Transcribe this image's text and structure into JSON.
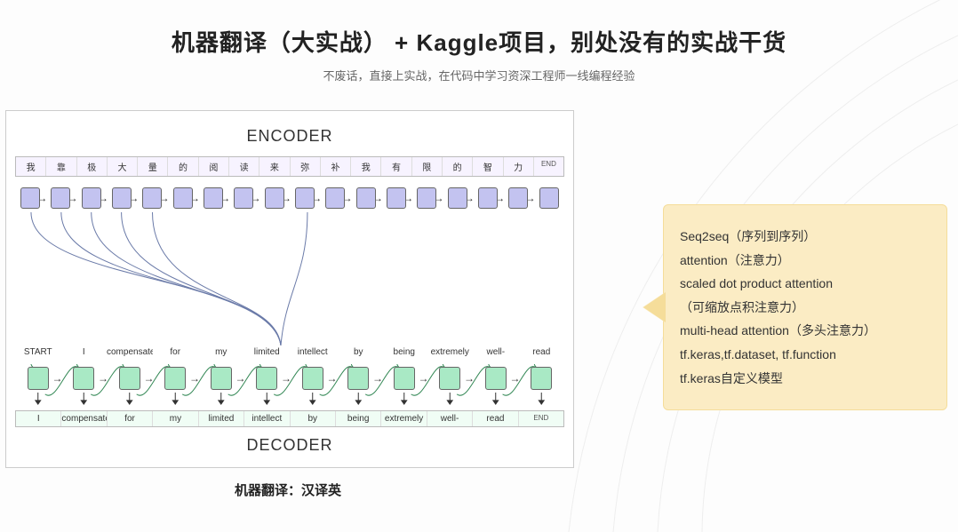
{
  "header": {
    "title": "机器翻译（大实战） + Kaggle项目，别处没有的实战干货",
    "subtitle": "不废话，直接上实战，在代码中学习资深工程师一线编程经验"
  },
  "diagram": {
    "encoder_label": "ENCODER",
    "decoder_label": "DECODER",
    "encoder_tokens": [
      "我",
      "靠",
      "极",
      "大",
      "量",
      "的",
      "阅",
      "读",
      "来",
      "弥",
      "补",
      "我",
      "有",
      "限",
      "的",
      "智",
      "力",
      "END"
    ],
    "decoder_inputs": [
      "START",
      "I",
      "compensate",
      "for",
      "my",
      "limited",
      "intellect",
      "by",
      "being",
      "extremely",
      "well-",
      "read"
    ],
    "decoder_outputs": [
      "I",
      "compensate",
      "for",
      "my",
      "limited",
      "intellect",
      "by",
      "being",
      "extremely",
      "well-",
      "read",
      "END"
    ]
  },
  "caption": "机器翻译：汉译英",
  "sidebox": {
    "l1": "Seq2seq（序列到序列）",
    "l2": " attention（注意力）",
    "l3": " scaled dot product attention",
    "l4": " （可缩放点积注意力）",
    "l5": "multi-head attention（多头注意力）",
    "l6": "tf.keras,tf.dataset, tf.function",
    "l7": "tf.keras自定义模型"
  }
}
